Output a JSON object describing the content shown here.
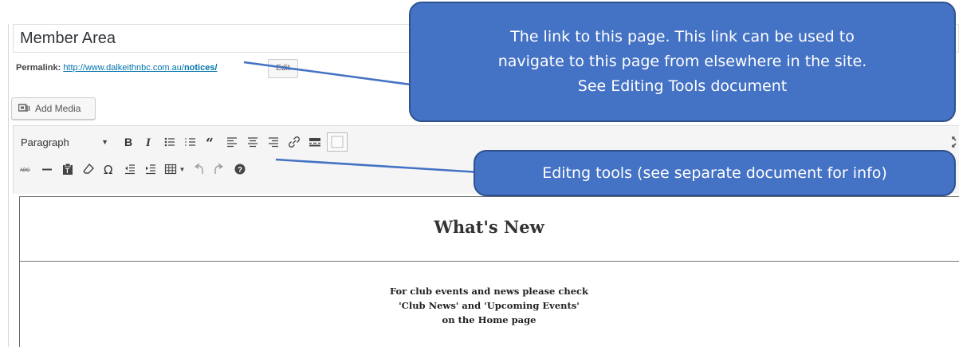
{
  "title_field": {
    "value": "Member Area"
  },
  "permalink": {
    "label": "Permalink:",
    "url_base": "http://www.dalkeithnbc.com.au/",
    "url_slug": "notices/",
    "edit_label": "Edit"
  },
  "add_media": {
    "label": "Add Media"
  },
  "toolbar": {
    "format_select": "Paragraph",
    "row1_icons": [
      "bold-icon",
      "italic-icon",
      "bulleted-list-icon",
      "numbered-list-icon",
      "blockquote-icon",
      "align-left-icon",
      "align-center-icon",
      "align-right-icon",
      "link-icon",
      "read-more-icon",
      "toolbar-toggle-icon"
    ],
    "row2_icons": [
      "strikethrough-icon",
      "horizontal-line-icon",
      "paste-as-text-icon",
      "clear-formatting-icon",
      "special-character-icon",
      "outdent-icon",
      "indent-icon",
      "table-icon",
      "undo-icon",
      "redo-icon",
      "help-icon"
    ]
  },
  "callouts": {
    "permalink_note": {
      "line1": "The link to this page. This link can be used to",
      "line2": "navigate to this page from elsewhere in the site.",
      "line3": "See Editing Tools document"
    },
    "tools_note": "Editng tools (see separate document for info)"
  },
  "content": {
    "heading": "What's New",
    "para_lines": [
      "For club events and news please check",
      "'Club News' and 'Upcoming Events'",
      "on the Home page"
    ]
  },
  "colors": {
    "callout_fill": "#4472c4",
    "callout_border": "#2f528f",
    "link": "#0073aa"
  }
}
